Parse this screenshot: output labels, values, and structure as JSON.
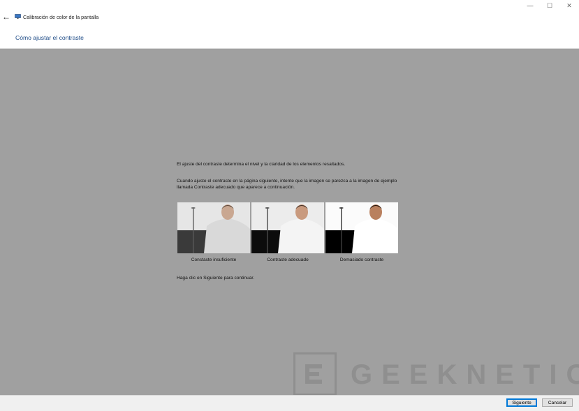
{
  "window": {
    "title": "Calibración de color de la pantalla",
    "controls": {
      "minimize": "—",
      "maximize": "☐",
      "close": "✕"
    },
    "back_glyph": "←"
  },
  "header": {
    "title": "Cómo ajustar el contraste"
  },
  "content": {
    "para1": "El ajuste del contraste determina el nivel y la claridad de los elementos resaltados.",
    "para2": "Cuando ajuste el contraste en la página siguiente, intente que la imagen se parezca a la imagen de ejemplo llamada Contraste adecuado que aparece a continuación.",
    "samples": [
      {
        "caption": "Constaste insuficiente"
      },
      {
        "caption": "Contraste adecuado"
      },
      {
        "caption": "Demasiado contraste"
      }
    ],
    "para3": "Haga clic en Siguiente para continuar."
  },
  "watermark": {
    "text": "GEEKNETIC"
  },
  "footer": {
    "next_label": "Siguiente",
    "cancel_label": "Cancelar"
  },
  "colors": {
    "background": "#a0a0a0",
    "title_blue": "#1c4a86",
    "focus_border": "#0078d7"
  }
}
